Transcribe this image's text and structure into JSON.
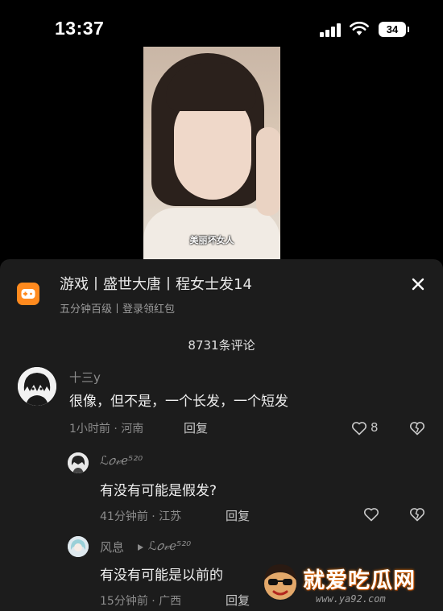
{
  "status_bar": {
    "time": "13:37",
    "battery": "34"
  },
  "video": {
    "caption": "美丽坏女人"
  },
  "sheet": {
    "game_title": "游戏丨盛世大唐丨程女士发14",
    "game_subtitle": "五分钟百级丨登录领红包",
    "comment_count": "8731条评论"
  },
  "comments": [
    {
      "user": "十三y",
      "text": "很像，但不是，一个长发，一个短发",
      "time_location": "1小时前 · 河南",
      "reply_label": "回复",
      "likes": "8"
    },
    {
      "user": "ℒ𝑜𝓋ℯ⁵²⁰",
      "text": "有没有可能是假发?",
      "time_location": "41分钟前 · 江苏",
      "reply_label": "回复"
    },
    {
      "user": "风息",
      "reply_to": "ℒ𝑜𝓋ℯ⁵²⁰",
      "text": "有没有可能是以前的",
      "time_location": "15分钟前 · 广西",
      "reply_label": "回复"
    }
  ],
  "watermark": {
    "text": "就爱吃瓜网",
    "url": "www.ya92.com"
  },
  "colors": {
    "background": "#000000",
    "sheet": "#1c1c1c",
    "game_icon": "#ff8a1e",
    "muted": "#8c8c8c"
  },
  "icons": [
    "signal-icon",
    "wifi-icon",
    "game-controller-icon",
    "close-icon",
    "heart-icon",
    "broken-heart-icon",
    "play-arrow-icon"
  ]
}
